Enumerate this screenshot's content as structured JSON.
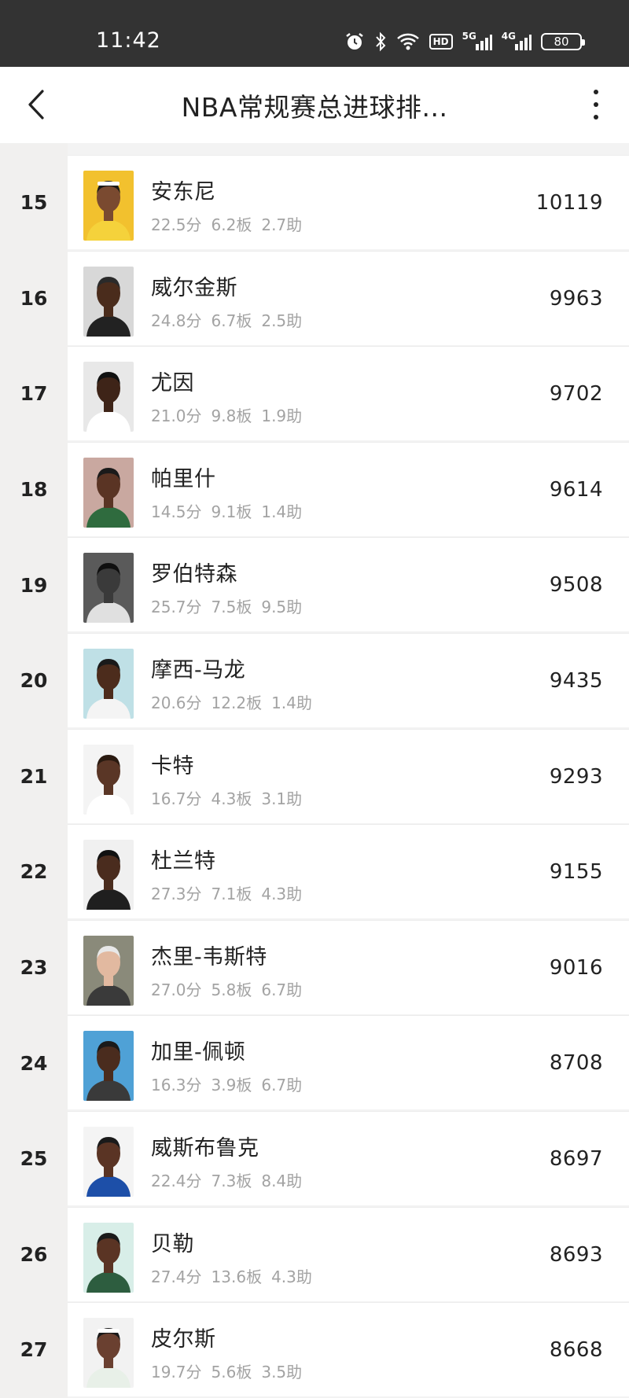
{
  "status_bar": {
    "time": "11:42",
    "battery": "80",
    "network1": "5G",
    "network2": "4G",
    "hd": "HD"
  },
  "header": {
    "title": "NBA常规赛总进球排..."
  },
  "players": [
    {
      "rank": "15",
      "name": "安东尼",
      "pts": "22.5分",
      "reb": "6.2板",
      "ast": "2.7助",
      "total": "10119",
      "bg": "#f2c12e",
      "skin": "#7a4a30",
      "jersey": "#f5d23b",
      "hair": "#1a1a1a",
      "band": "#ffffff"
    },
    {
      "rank": "16",
      "name": "威尔金斯",
      "pts": "24.8分",
      "reb": "6.7板",
      "ast": "2.5助",
      "total": "9963",
      "bg": "#d8d8d8",
      "skin": "#4a2c1c",
      "jersey": "#222222",
      "hair": "#2a2a2a",
      "band": ""
    },
    {
      "rank": "17",
      "name": "尤因",
      "pts": "21.0分",
      "reb": "9.8板",
      "ast": "1.9助",
      "total": "9702",
      "bg": "#e8e8e8",
      "skin": "#3e2418",
      "jersey": "#ffffff",
      "hair": "#111111",
      "band": ""
    },
    {
      "rank": "18",
      "name": "帕里什",
      "pts": "14.5分",
      "reb": "9.1板",
      "ast": "1.4助",
      "total": "9614",
      "bg": "#c9a8a0",
      "skin": "#5a3424",
      "jersey": "#2f6b3e",
      "hair": "#1a1a1a",
      "band": ""
    },
    {
      "rank": "19",
      "name": "罗伯特森",
      "pts": "25.7分",
      "reb": "7.5板",
      "ast": "9.5助",
      "total": "9508",
      "bg": "#5a5a5a",
      "skin": "#3a3a3a",
      "jersey": "#e0e0e0",
      "hair": "#0f0f0f",
      "band": ""
    },
    {
      "rank": "20",
      "name": "摩西-马龙",
      "pts": "20.6分",
      "reb": "12.2板",
      "ast": "1.4助",
      "total": "9435",
      "bg": "#bfe0e6",
      "skin": "#4c2c1c",
      "jersey": "#f4f4f4",
      "hair": "#1a1a1a",
      "band": ""
    },
    {
      "rank": "21",
      "name": "卡特",
      "pts": "16.7分",
      "reb": "4.3板",
      "ast": "3.1助",
      "total": "9293",
      "bg": "#f4f4f4",
      "skin": "#5a3626",
      "jersey": "#ffffff",
      "hair": "#2a1a10",
      "band": ""
    },
    {
      "rank": "22",
      "name": "杜兰特",
      "pts": "27.3分",
      "reb": "7.1板",
      "ast": "4.3助",
      "total": "9155",
      "bg": "#f0f0f0",
      "skin": "#4a2c1e",
      "jersey": "#1f1f1f",
      "hair": "#111111",
      "band": ""
    },
    {
      "rank": "23",
      "name": "杰里-韦斯特",
      "pts": "27.0分",
      "reb": "5.8板",
      "ast": "6.7助",
      "total": "9016",
      "bg": "#8a8a7a",
      "skin": "#e2b9a0",
      "jersey": "#3a3a3a",
      "hair": "#e8e8e8",
      "band": ""
    },
    {
      "rank": "24",
      "name": "加里-佩顿",
      "pts": "16.3分",
      "reb": "3.9板",
      "ast": "6.7助",
      "total": "8708",
      "bg": "#4fa1d6",
      "skin": "#4a2c1e",
      "jersey": "#3a3a3a",
      "hair": "#1a1a1a",
      "band": ""
    },
    {
      "rank": "25",
      "name": "威斯布鲁克",
      "pts": "22.4分",
      "reb": "7.3板",
      "ast": "8.4助",
      "total": "8697",
      "bg": "#f4f4f4",
      "skin": "#5a3424",
      "jersey": "#1d4fa8",
      "hair": "#1a1a1a",
      "band": ""
    },
    {
      "rank": "26",
      "name": "贝勒",
      "pts": "27.4分",
      "reb": "13.6板",
      "ast": "4.3助",
      "total": "8693",
      "bg": "#d8eee8",
      "skin": "#5a3424",
      "jersey": "#2d5d3f",
      "hair": "#1a1a1a",
      "band": ""
    },
    {
      "rank": "27",
      "name": "皮尔斯",
      "pts": "19.7分",
      "reb": "5.6板",
      "ast": "3.5助",
      "total": "8668",
      "bg": "#f2f2f2",
      "skin": "#6a4030",
      "jersey": "#e8f0e8",
      "hair": "#1a1a1a",
      "band": "#ffffff"
    }
  ]
}
